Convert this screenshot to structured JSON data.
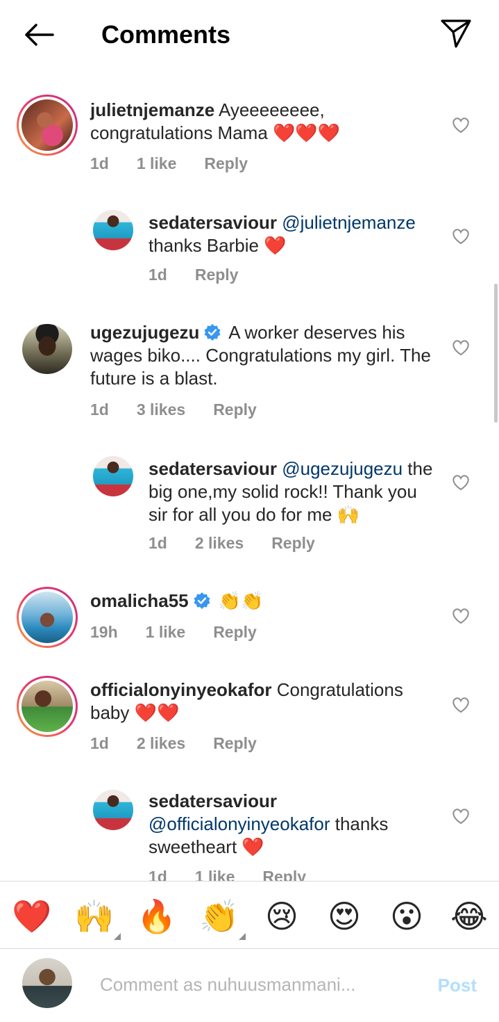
{
  "header": {
    "title": "Comments"
  },
  "comments": [
    {
      "username": "julietnjemanze",
      "text": " Ayeeeeeeee, congratulations Mama ❤️❤️❤️",
      "time": "1d",
      "likes": "1 like",
      "reply": "Reply",
      "is_reply": false
    },
    {
      "username": "sedatersaviour",
      "mention": "@julietnjemanze",
      "text": " thanks Barbie ❤️",
      "time": "1d",
      "likes": "",
      "reply": "Reply",
      "is_reply": true
    },
    {
      "username": "ugezujugezu",
      "verified": true,
      "text": "A worker deserves his wages biko.... Congratulations my girl. The future is a blast.",
      "time": "1d",
      "likes": "3 likes",
      "reply": "Reply",
      "is_reply": false
    },
    {
      "username": "sedatersaviour",
      "mention": "@ugezujugezu",
      "text": " the big one,my solid rock!! Thank you sir for all you do for me 🙌",
      "time": "1d",
      "likes": "2 likes",
      "reply": "Reply",
      "is_reply": true
    },
    {
      "username": "omalicha55",
      "verified": true,
      "text": "👏👏",
      "time": "19h",
      "likes": "1 like",
      "reply": "Reply",
      "is_reply": false
    },
    {
      "username": "officialonyinyeokafor",
      "text": " Congratulations baby ❤️❤️",
      "time": "1d",
      "likes": "2 likes",
      "reply": "Reply",
      "is_reply": false
    },
    {
      "username": "sedatersaviour",
      "mention": "@officialonyinyeokafor",
      "text": " thanks sweetheart ❤️",
      "time": "1d",
      "likes": "1 like",
      "reply": "Reply",
      "is_reply": true
    }
  ],
  "emoji_bar": [
    "❤️",
    "🙌",
    "🔥",
    "👏",
    "😢",
    "😍",
    "😮",
    "😂"
  ],
  "input": {
    "placeholder": "Comment as nuhuusmanmani...",
    "post_label": "Post"
  },
  "colors": {
    "link": "#00376b",
    "meta": "#8e8e8e",
    "post": "#b2dffc",
    "verified": "#3897f0"
  }
}
